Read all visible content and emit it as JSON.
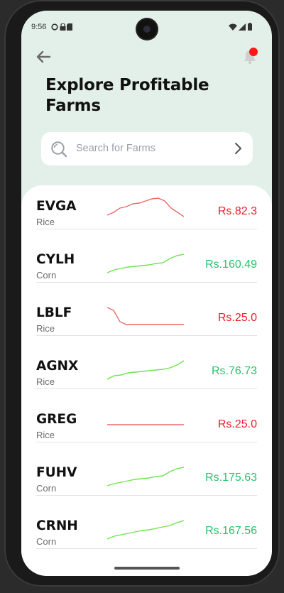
{
  "status_bar": {
    "time": "9:56"
  },
  "header": {
    "title": "Explore Profitable Farms",
    "search_placeholder": "Search for Farms"
  },
  "colors": {
    "up": "#27c26a",
    "down": "#ec1c24",
    "background": "#e3efe9"
  },
  "farms": [
    {
      "code": "EVGA",
      "crop": "Rice",
      "price": "Rs.82.3",
      "trend": "down",
      "spark": [
        10,
        14,
        20,
        22,
        26,
        27,
        30,
        33,
        34,
        30,
        20,
        14,
        8
      ]
    },
    {
      "code": "CYLH",
      "crop": "Corn",
      "price": "Rs.160.49",
      "trend": "up",
      "spark": [
        4,
        8,
        10,
        12,
        13,
        14,
        15,
        17,
        18,
        24,
        28,
        30
      ]
    },
    {
      "code": "LBLF",
      "crop": "Rice",
      "price": "Rs.25.0",
      "trend": "down",
      "spark": [
        30,
        26,
        10,
        6,
        6,
        6,
        6,
        6,
        6,
        6,
        6,
        6,
        6
      ]
    },
    {
      "code": "AGNX",
      "crop": "Rice",
      "price": "Rs.76.73",
      "trend": "up",
      "spark": [
        4,
        9,
        10,
        13,
        14,
        15,
        16,
        17,
        18,
        20,
        24,
        30
      ]
    },
    {
      "code": "GREG",
      "crop": "Rice",
      "price": "Rs.25.0",
      "trend": "down",
      "spark": [
        15,
        15,
        15,
        15,
        15,
        15,
        15,
        15,
        15,
        15,
        15,
        15
      ]
    },
    {
      "code": "FUHV",
      "crop": "Corn",
      "price": "Rs.175.63",
      "trend": "up",
      "spark": [
        4,
        7,
        9,
        11,
        13,
        14,
        15,
        17,
        18,
        24,
        28,
        30
      ]
    },
    {
      "code": "CRNH",
      "crop": "Corn",
      "price": "Rs.167.56",
      "trend": "up",
      "spark": [
        4,
        8,
        10,
        12,
        14,
        16,
        17,
        19,
        21,
        23,
        27,
        30
      ]
    }
  ]
}
